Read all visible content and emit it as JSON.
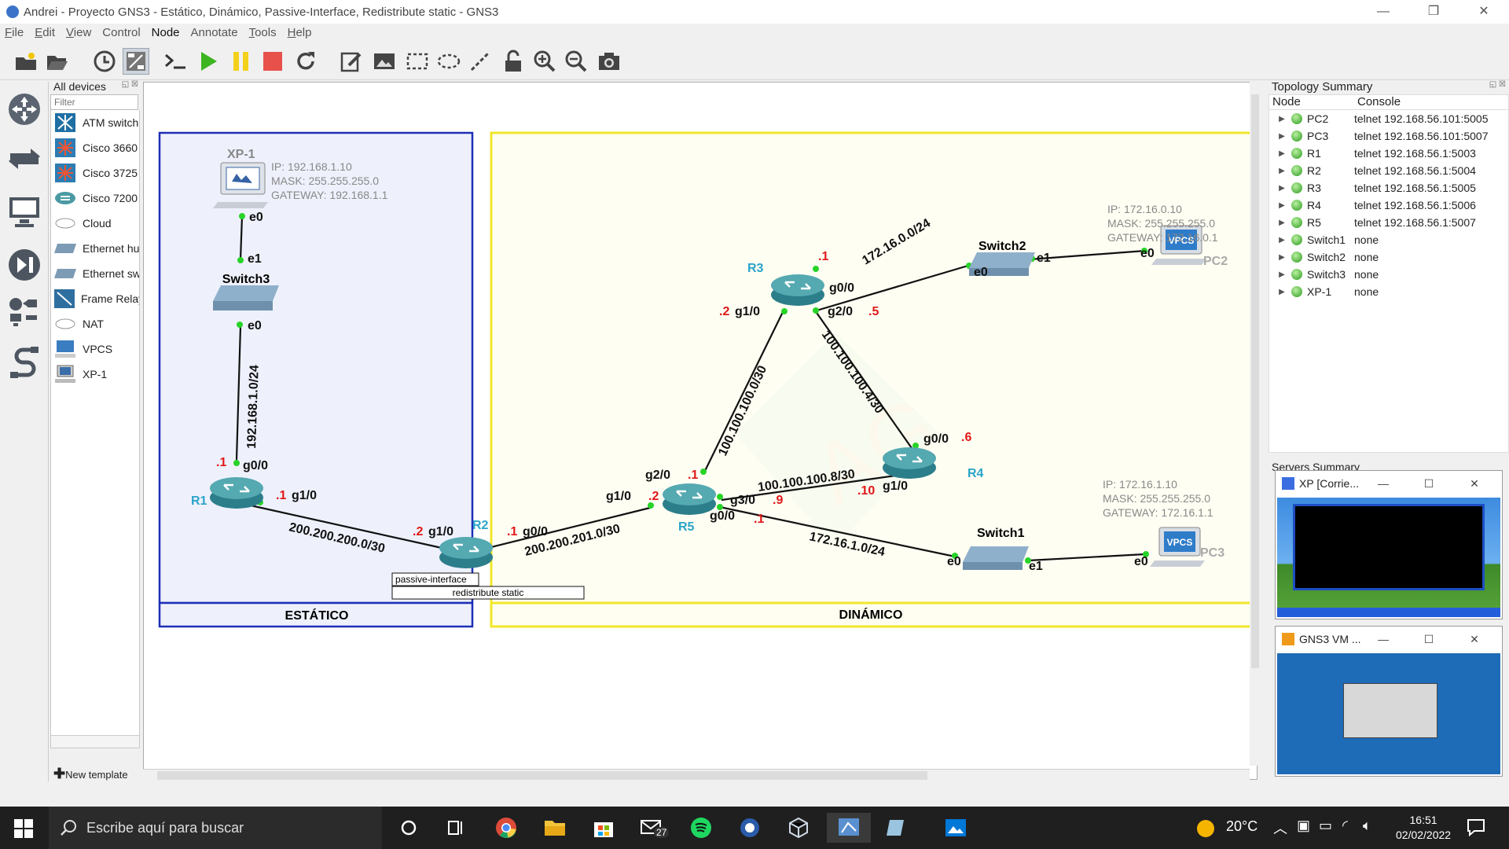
{
  "window": {
    "title": "Andrei - Proyecto GNS3 - Estático, Dinámico, Passive-Interface, Redistribute static - GNS3",
    "min": "—",
    "max": "❐",
    "close": "✕"
  },
  "menu": [
    "File",
    "Edit",
    "View",
    "Control",
    "Node",
    "Annotate",
    "Tools",
    "Help"
  ],
  "devices": {
    "header": "All devices",
    "filter_placeholder": "Filter",
    "new_template": "New template",
    "items": [
      "ATM switch",
      "Cisco 3660",
      "Cisco 3725",
      "Cisco 7200",
      "Cloud",
      "Ethernet hub",
      "Ethernet switch",
      "Frame Relay switch",
      "NAT",
      "VPCS",
      "XP-1"
    ]
  },
  "topology_summary": {
    "header": "Topology Summary",
    "col_node": "Node",
    "col_console": "Console",
    "rows": [
      {
        "node": "PC2",
        "console": "telnet 192.168.56.101:5005"
      },
      {
        "node": "PC3",
        "console": "telnet 192.168.56.101:5007"
      },
      {
        "node": "R1",
        "console": "telnet 192.168.56.1:5003"
      },
      {
        "node": "R2",
        "console": "telnet 192.168.56.1:5004"
      },
      {
        "node": "R3",
        "console": "telnet 192.168.56.1:5005"
      },
      {
        "node": "R4",
        "console": "telnet 192.168.56.1:5006"
      },
      {
        "node": "R5",
        "console": "telnet 192.168.56.1:5007"
      },
      {
        "node": "Switch1",
        "console": "none"
      },
      {
        "node": "Switch2",
        "console": "none"
      },
      {
        "node": "Switch3",
        "console": "none"
      },
      {
        "node": "XP-1",
        "console": "none"
      }
    ]
  },
  "servers_summary": "Servers Summary",
  "thumbnails": [
    {
      "title": "XP [Corrie..."
    },
    {
      "title": "GNS3 VM ..."
    }
  ],
  "topology": {
    "zones": {
      "static": "ESTÁTICO",
      "dynamic": "DINÁMICO"
    },
    "notes": {
      "passive": "passive-interface",
      "redistribute": "redistribute static"
    },
    "nodes": {
      "xp1": "XP-1",
      "switch3": "Switch3",
      "r1": "R1",
      "r2": "R2",
      "r3": "R3",
      "r4": "R4",
      "r5": "R5",
      "switch1": "Switch1",
      "switch2": "Switch2",
      "pc2": "PC2",
      "pc3": "PC3",
      "vpcs": "VPCS"
    },
    "ports": {
      "xp_e0": "e0",
      "s3_e1": "e1",
      "s3_e0": "e0",
      "r1_g00": "g0/0",
      "r1_g10": "g1/0",
      "r1_ip_g00": ".1",
      "r1_ip_g10": ".1",
      "r2_g10": "g1/0",
      "r2_g00": "g0/0",
      "r2_ip_g10": ".2",
      "r2_ip_g00": ".1",
      "r5_g10": "g1/0",
      "r5_g20": "g2/0",
      "r5_g30": "g3/0",
      "r5_g00": "g0/0",
      "r5_ip_g10": ".2",
      "r5_ip_g20": ".1",
      "r5_ip_g30": ".9",
      "r5_ip_g00": ".1",
      "r3_g10": "g1/0",
      "r3_g00": "g0/0",
      "r3_g20": "g2/0",
      "r3_ip_g10": ".2",
      "r3_ip_g00": ".1",
      "r3_ip_g20": ".5",
      "r4_g00": "g0/0",
      "r4_g10": "g1/0",
      "r4_ip_g00": ".6",
      "r4_ip_g10": ".10",
      "sw2_e0": "e0",
      "sw2_e1": "e1",
      "pc2_e0": "e0",
      "sw1_e0": "e0",
      "sw1_e1": "e1",
      "pc3_e0": "e0"
    },
    "networks": {
      "n1": "192.168.1.0/24",
      "n2": "200.200.200.0/30",
      "n3": "200.200.201.0/30",
      "n4": "100.100.100.0/30",
      "n5": "100.100.100.4/30",
      "n6": "100.100.100.8/30",
      "n7": "172.16.0.0/24",
      "n8": "172.16.1.0/24"
    },
    "info": {
      "xp": [
        "IP: 192.168.1.10",
        "MASK: 255.255.255.0",
        "GATEWAY: 192.168.1.1"
      ],
      "pc2": [
        "IP: 172.16.0.10",
        "MASK: 255.255.255.0",
        "GATEWAY: 172.16.0.1"
      ],
      "pc3": [
        "IP: 172.16.1.10",
        "MASK: 255.255.255.0",
        "GATEWAY: 172.16.1.1"
      ]
    }
  },
  "taskbar": {
    "search": "Escribe aquí para buscar",
    "temp": "20°C",
    "time": "16:51",
    "date": "02/02/2022",
    "badge": "27"
  }
}
